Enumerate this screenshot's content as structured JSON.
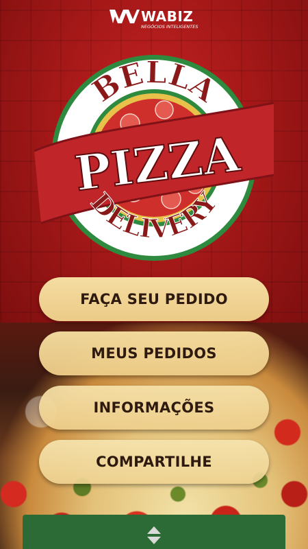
{
  "branding": {
    "company_name": "WABIZ",
    "company_tagline": "NEGÓCIOS INTELIGENTES",
    "company_logo_icon": "wabiz-logo-icon"
  },
  "emblem": {
    "line1": "BELLA",
    "line2": "PIZZA",
    "line3": "DELIVERY"
  },
  "menu": {
    "buttons": [
      {
        "label": "FAÇA SEU PEDIDO"
      },
      {
        "label": "MEUS PEDIDOS"
      },
      {
        "label": "INFORMAÇÕES"
      },
      {
        "label": "COMPARTILHE"
      }
    ]
  },
  "bottom_bar": {
    "handle_icon": "up-down-arrows-icon"
  },
  "colors": {
    "background_red": "#a51818",
    "button_fill": "#efd193",
    "button_text": "#2f1a10",
    "ribbon_red": "#c0252a",
    "emblem_green": "#2d8a3e",
    "bottom_bar_green": "#2c6b35"
  }
}
